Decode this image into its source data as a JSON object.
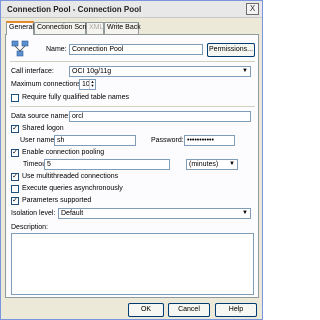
{
  "window": {
    "title": "Connection Pool - Connection Pool",
    "close_label": "X"
  },
  "tabs": [
    {
      "label": "General"
    },
    {
      "label": "Connection Scripts"
    },
    {
      "label": "XML"
    },
    {
      "label": "Write Back"
    }
  ],
  "general": {
    "name_label": "Name:",
    "name_value": "Connection Pool",
    "permissions_label": "Permissions...",
    "call_interface_label": "Call interface:",
    "call_interface_value": "OCI 10g/11g",
    "max_connections_label": "Maximum connections:",
    "max_connections_value": "10",
    "require_fq_label": "Require fully qualified table names",
    "require_fq_checked": false,
    "data_source_label": "Data source name:",
    "data_source_value": "orcl",
    "shared_logon_label": "Shared logon",
    "shared_logon_checked": true,
    "user_name_label": "User name:",
    "user_name_value": "sh",
    "password_label": "Password:",
    "password_value": "•••••••••••",
    "pooling_label": "Enable connection pooling",
    "pooling_checked": true,
    "timeout_label": "Timeout:",
    "timeout_value": "5",
    "timeout_unit": "(minutes)",
    "multithreaded_label": "Use multithreaded connections",
    "multithreaded_checked": true,
    "async_label": "Execute queries asynchronously",
    "async_checked": false,
    "params_label": "Parameters supported",
    "params_checked": true,
    "isolation_label": "Isolation level:",
    "isolation_value": "Default",
    "description_label": "Description:",
    "description_value": ""
  },
  "footer": {
    "ok_label": "OK",
    "cancel_label": "Cancel",
    "help_label": "Help"
  },
  "check_mark": "✓",
  "dropdown_arrow": "▼",
  "spin_up": "▲",
  "spin_down": "▼"
}
